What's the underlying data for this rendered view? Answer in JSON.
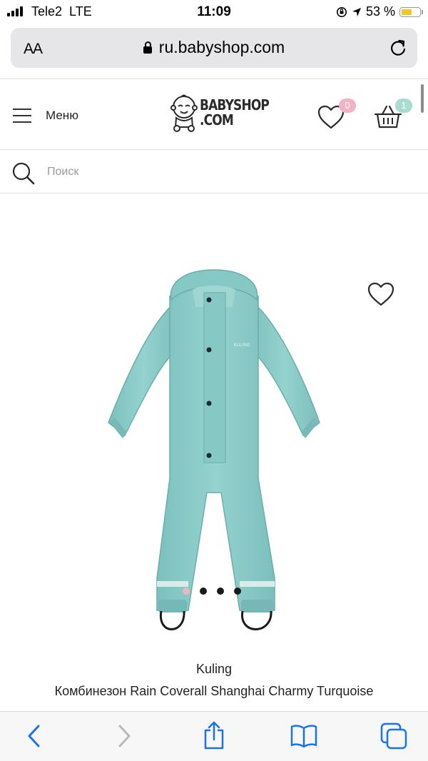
{
  "status_bar": {
    "carrier": "Tele2",
    "network": "LTE",
    "time": "11:09",
    "battery": "53 %",
    "battery_level": 0.53,
    "icons": [
      "signal-icon",
      "orientation-lock-icon",
      "location-icon",
      "battery-icon"
    ]
  },
  "browser": {
    "text_size_label": "AA",
    "url": "ru.babyshop.com",
    "icons": [
      "lock-icon",
      "reload-icon"
    ]
  },
  "header": {
    "menu_label": "Меню",
    "logo_line1": "BABYSHOP",
    "logo_line2": ".COM",
    "wishlist_count": "0",
    "cart_count": "1",
    "colors": {
      "wishlist_badge": "#f2b4c4",
      "cart_badge": "#a9dcd0"
    }
  },
  "search": {
    "placeholder": "Поиск"
  },
  "product": {
    "brand": "Kuling",
    "name": "Комбинезон Rain Coverall Shanghai Charmy Turquoise",
    "garment_logo": "KULING",
    "image_count": 4,
    "active_image": 1,
    "colors": {
      "garment": "#8ecdc9",
      "dot_active": "#f2b4c4",
      "dot": "#1a1a1a"
    }
  },
  "toolbar": {
    "icons": [
      "back-icon",
      "forward-icon",
      "share-icon",
      "bookmarks-icon",
      "tabs-icon"
    ],
    "colors": {
      "active": "#1a73e8",
      "disabled": "#b8b8b8"
    }
  }
}
